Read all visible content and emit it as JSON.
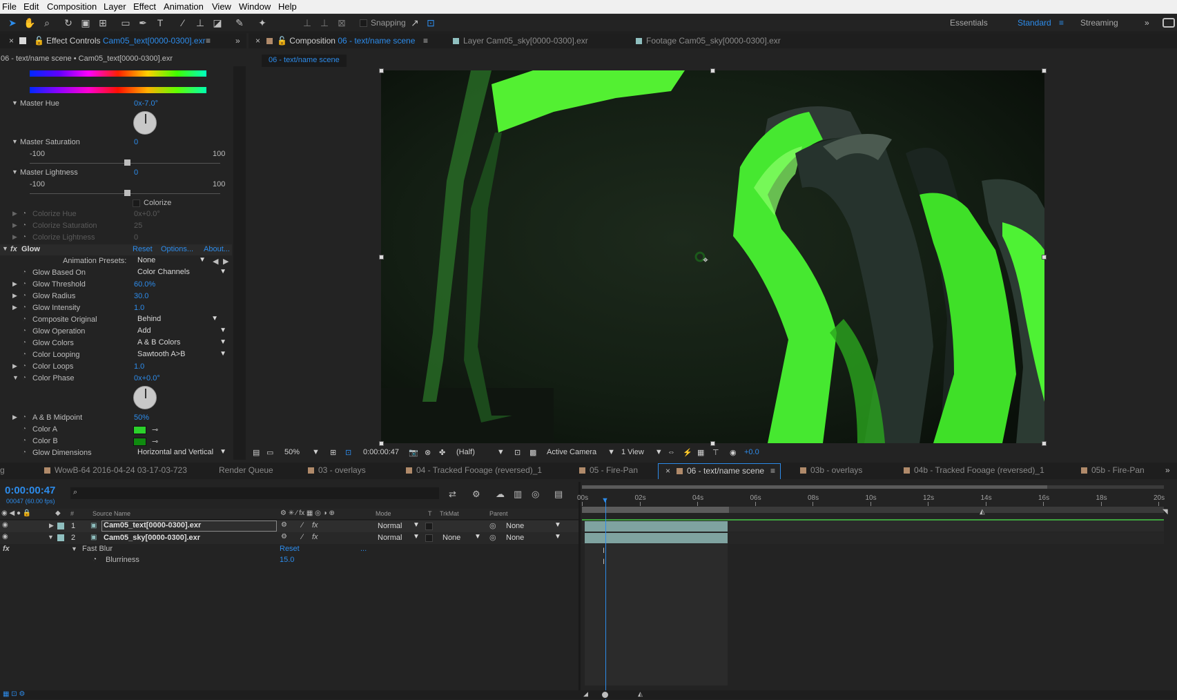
{
  "menu": [
    "File",
    "Edit",
    "Composition",
    "Layer",
    "Effect",
    "Animation",
    "View",
    "Window",
    "Help"
  ],
  "toolbar": {
    "snapping": "Snapping",
    "workspaces": [
      "Essentials",
      "Standard",
      "Streaming"
    ]
  },
  "effect_panel": {
    "tab_label": "Effect Controls",
    "tab_layer": "Cam05_text[0000-0300].exr",
    "breadcrumb": "06 - text/name scene • Cam05_text[0000-0300].exr",
    "master_hue": {
      "label": "Master Hue",
      "value": "0x-7.0°"
    },
    "master_saturation": {
      "label": "Master Saturation",
      "value": "0",
      "min": "-100",
      "max": "100"
    },
    "master_lightness": {
      "label": "Master Lightness",
      "value": "0",
      "min": "-100",
      "max": "100"
    },
    "colorize": "Colorize",
    "colorize_hue": {
      "label": "Colorize Hue",
      "value": "0x+0.0°"
    },
    "colorize_saturation": {
      "label": "Colorize Saturation",
      "value": "25"
    },
    "colorize_lightness": {
      "label": "Colorize Lightness",
      "value": "0"
    },
    "glow": {
      "label": "Glow",
      "reset": "Reset",
      "options": "Options...",
      "about": "About..."
    },
    "animation_presets": {
      "label": "Animation Presets:",
      "value": "None"
    },
    "glow_based_on": {
      "label": "Glow Based On",
      "value": "Color Channels"
    },
    "glow_threshold": {
      "label": "Glow Threshold",
      "value": "60.0%"
    },
    "glow_radius": {
      "label": "Glow Radius",
      "value": "30.0"
    },
    "glow_intensity": {
      "label": "Glow Intensity",
      "value": "1.0"
    },
    "composite_original": {
      "label": "Composite Original",
      "value": "Behind"
    },
    "glow_operation": {
      "label": "Glow Operation",
      "value": "Add"
    },
    "glow_colors": {
      "label": "Glow Colors",
      "value": "A & B Colors"
    },
    "color_looping": {
      "label": "Color Looping",
      "value": "Sawtooth A>B"
    },
    "color_loops": {
      "label": "Color Loops",
      "value": "1.0"
    },
    "color_phase": {
      "label": "Color Phase",
      "value": "0x+0.0°"
    },
    "ab_midpoint": {
      "label": "A & B Midpoint",
      "value": "50%"
    },
    "color_a": {
      "label": "Color A",
      "color": "#2bd12b"
    },
    "color_b": {
      "label": "Color B",
      "color": "#0f8a0f"
    },
    "glow_dimensions": {
      "label": "Glow Dimensions",
      "value": "Horizontal and Vertical"
    }
  },
  "comp_panel": {
    "tabs": [
      {
        "prefix": "Composition",
        "name": "06 - text/name scene"
      },
      {
        "prefix": "Layer",
        "name": "Cam05_sky[0000-0300].exr"
      },
      {
        "prefix": "Footage",
        "name": "Cam05_sky[0000-0300].exr"
      }
    ],
    "subtab": "06 - text/name scene",
    "zoom": "50%",
    "timecode": "0:00:00:47",
    "resolution": "(Half)",
    "camera": "Active Camera",
    "views": "1 View",
    "exposure": "+0.0"
  },
  "timeline": {
    "tabs": [
      "g",
      "WowB-64 2016-04-24 03-17-03-723",
      "Render Queue",
      "03 - overlays",
      "04 - Tracked Fooage (reversed)_1",
      "05 - Fire-Pan",
      "06 - text/name scene",
      "03b - overlays",
      "04b - Tracked Fooage (reversed)_1",
      "05b - Fire-Pan"
    ],
    "timecode": "0:00:00:47",
    "frames": "00047 (60.00 fps)",
    "headers": {
      "source": "Source Name",
      "mode": "Mode",
      "t": "T",
      "trkmat": "TrkMat",
      "parent": "Parent"
    },
    "layers": [
      {
        "num": "1",
        "name": "Cam05_text[0000-0300].exr",
        "mode": "Normal",
        "trkmat": "",
        "parent": "None"
      },
      {
        "num": "2",
        "name": "Cam05_sky[0000-0300].exr",
        "mode": "Normal",
        "trkmat": "None",
        "parent": "None"
      }
    ],
    "effect": {
      "name": "Fast Blur",
      "reset": "Reset",
      "dots": "...",
      "prop": "Blurriness",
      "value": "15.0"
    },
    "ticks": [
      "00s",
      "02s",
      "04s",
      "06s",
      "08s",
      "10s",
      "12s",
      "14s",
      "16s",
      "18s",
      "20s"
    ]
  }
}
